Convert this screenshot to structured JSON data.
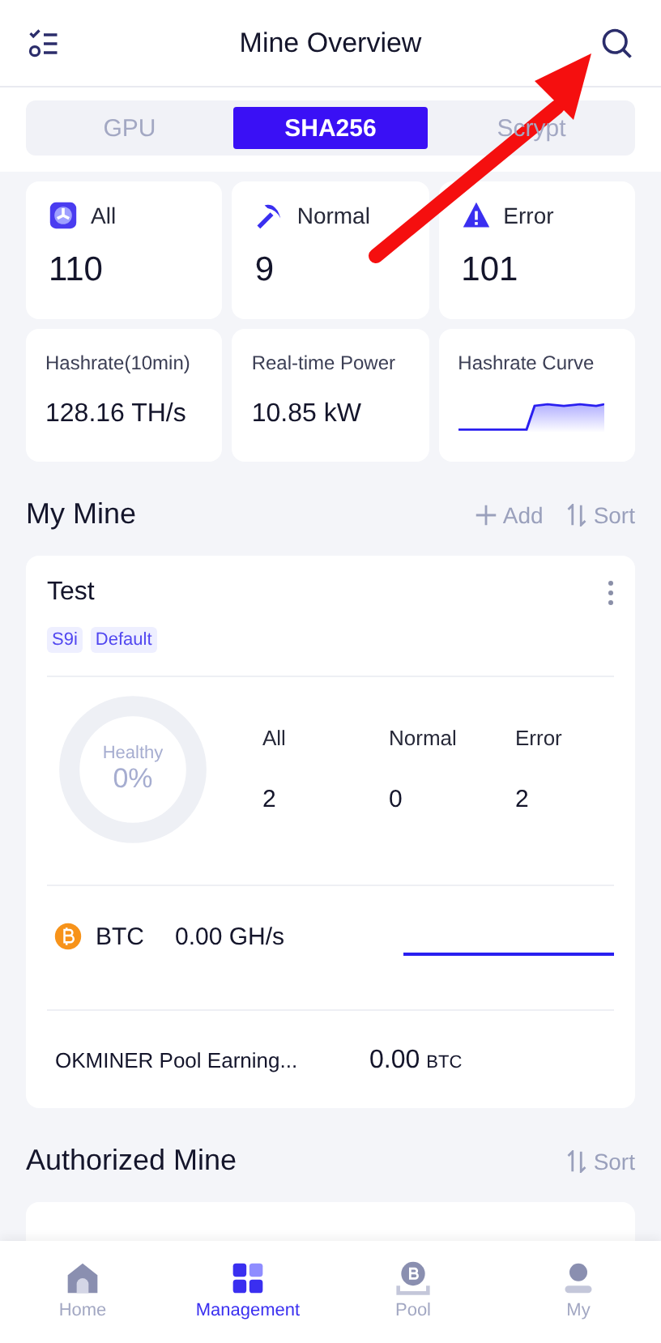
{
  "header": {
    "title": "Mine Overview"
  },
  "algo_tabs": [
    {
      "label": "GPU",
      "selected": false
    },
    {
      "label": "SHA256",
      "selected": true
    },
    {
      "label": "Scrypt",
      "selected": false
    }
  ],
  "status_cards": [
    {
      "kind": "all",
      "label": "All",
      "value": "110"
    },
    {
      "kind": "normal",
      "label": "Normal",
      "value": "9"
    },
    {
      "kind": "error",
      "label": "Error",
      "value": "101"
    }
  ],
  "metric_cards": [
    {
      "kind": "value",
      "label": "Hashrate(10min)",
      "value": "128.16 TH/s"
    },
    {
      "kind": "value",
      "label": "Real-time Power",
      "value": "10.85 kW"
    },
    {
      "kind": "curve",
      "label": "Hashrate Curve"
    }
  ],
  "my_mine": {
    "title": "My Mine",
    "actions": [
      {
        "kind": "add",
        "label": "Add"
      },
      {
        "kind": "sort",
        "label": "Sort"
      }
    ],
    "mines": [
      {
        "name": "Test",
        "tags": [
          "S9i",
          "Default"
        ],
        "health": {
          "label": "Healthy",
          "value": "0%",
          "level": 0
        },
        "counts": [
          {
            "label": "All",
            "value": "2"
          },
          {
            "label": "Normal",
            "value": "0"
          },
          {
            "label": "Error",
            "value": "2"
          }
        ],
        "coin": "BTC",
        "hashrate": "0.00 GH/s",
        "earnings_label": "OKMINER Pool Earning...",
        "earnings_value": "0.00",
        "earnings_unit": "BTC"
      }
    ]
  },
  "authorized_mine": {
    "title": "Authorized Mine",
    "actions": [
      {
        "kind": "sort",
        "label": "Sort"
      }
    ]
  },
  "bottom_nav": [
    {
      "kind": "home",
      "label": "Home",
      "selected": false
    },
    {
      "kind": "grid",
      "label": "Management",
      "selected": true
    },
    {
      "kind": "pool",
      "label": "Pool",
      "selected": false
    },
    {
      "kind": "user",
      "label": "My",
      "selected": false
    }
  ]
}
